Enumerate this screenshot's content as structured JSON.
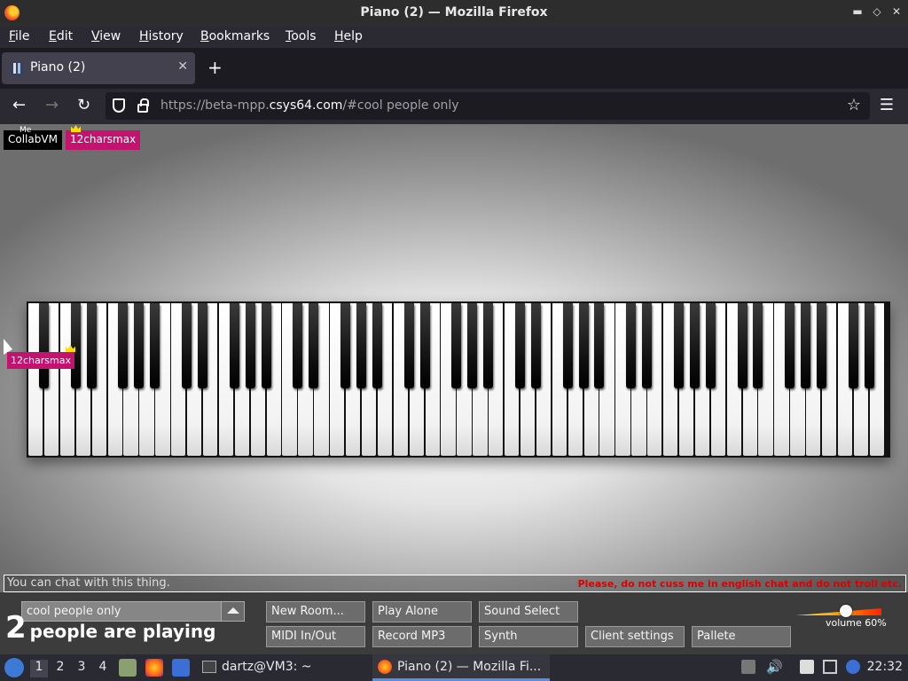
{
  "window": {
    "title": "Piano (2) — Mozilla Firefox"
  },
  "menubar": [
    "File",
    "Edit",
    "View",
    "History",
    "Bookmarks",
    "Tools",
    "Help"
  ],
  "tab": {
    "label": "Piano (2)",
    "close": "✕",
    "new": "+"
  },
  "nav": {
    "url_prefix": "https://beta-mpp.",
    "url_host": "csys64.com",
    "url_suffix": "/#cool people only"
  },
  "page": {
    "names": [
      {
        "name": "CollabVM",
        "tag": "Me",
        "color": "#000000"
      },
      {
        "name": "12charsmax",
        "color": "#c4136e",
        "owner": true
      }
    ],
    "cursor_label": "12charsmax",
    "chat_placeholder": "You can chat with this thing.",
    "chat_notice": "Please, do not cuss me in english chat and do not troll etc.",
    "room_name": "cool people only",
    "player_count": "2",
    "player_text": "people are playing",
    "buttons_row1": [
      "New Room...",
      "Play Alone",
      "Sound Select"
    ],
    "buttons_row2": [
      "MIDI In/Out",
      "Record MP3",
      "Synth",
      "Client settings",
      "Pallete"
    ],
    "volume_label": "volume 60%",
    "volume": 0.6
  },
  "taskbar": {
    "workspaces": [
      "1",
      "2",
      "3",
      "4"
    ],
    "terminal": "dartz@VM3: ~",
    "firefox": "Piano (2) — Mozilla Fi...",
    "clock": "22:32"
  },
  "colors": {
    "owner_tag": "#c4136e",
    "crown": "#ffdd00",
    "notice": "#dd0000"
  }
}
